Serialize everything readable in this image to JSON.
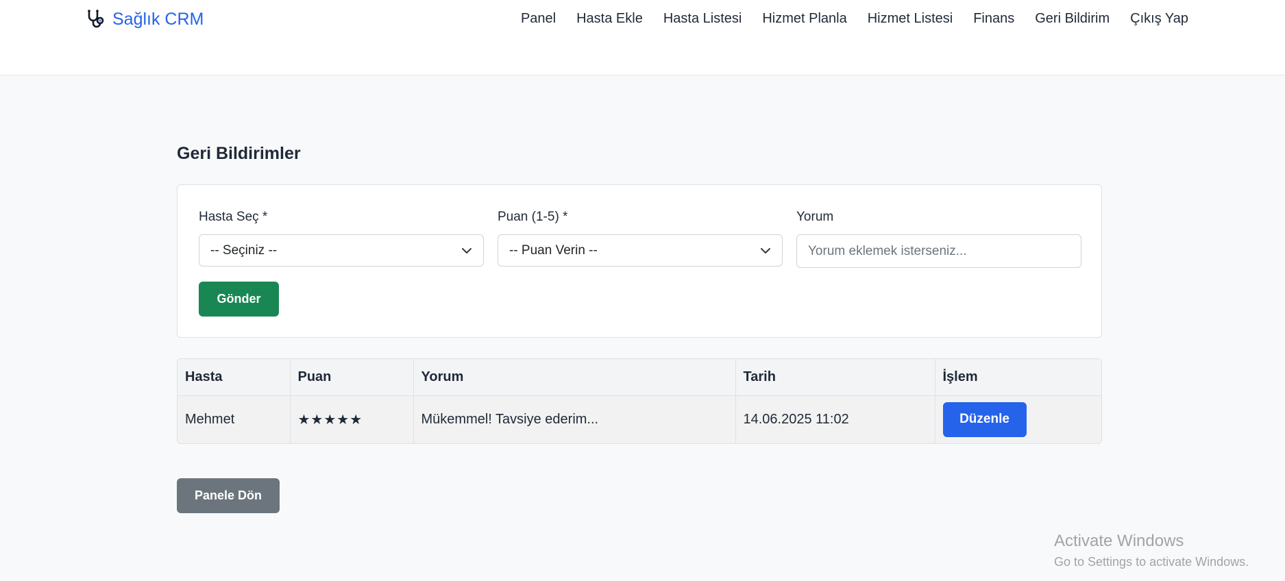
{
  "app": {
    "brand_name": "Sağlık CRM",
    "brand_icon": "stethoscope-icon",
    "brand_color": "#2563eb"
  },
  "nav": {
    "items": [
      {
        "label": "Panel"
      },
      {
        "label": "Hasta Ekle"
      },
      {
        "label": "Hasta Listesi"
      },
      {
        "label": "Hizmet Planla"
      },
      {
        "label": "Hizmet Listesi"
      },
      {
        "label": "Finans"
      },
      {
        "label": "Geri Bildirim"
      },
      {
        "label": "Çıkış Yap"
      }
    ]
  },
  "page": {
    "title": "Geri Bildirimler"
  },
  "form": {
    "patient_label": "Hasta Seç *",
    "patient_value": "-- Seçiniz --",
    "rating_label": "Puan (1-5) *",
    "rating_value": "-- Puan Verin --",
    "comment_label": "Yorum",
    "comment_placeholder": "Yorum eklemek isterseniz...",
    "submit_label": "Gönder",
    "submit_color": "#198754"
  },
  "table": {
    "headers": [
      "Hasta",
      "Puan",
      "Yorum",
      "Tarih",
      "İşlem"
    ],
    "rows": [
      {
        "patient": "Mehmet",
        "rating": "★★★★★",
        "comment": "Mükemmel! Tavsiye ederim...",
        "date": "14.06.2025 11:02",
        "action_label": "Düzenle"
      }
    ]
  },
  "footer": {
    "back_label": "Panele Dön"
  },
  "watermark": {
    "title": "Activate Windows",
    "subtitle": "Go to Settings to activate Windows."
  }
}
